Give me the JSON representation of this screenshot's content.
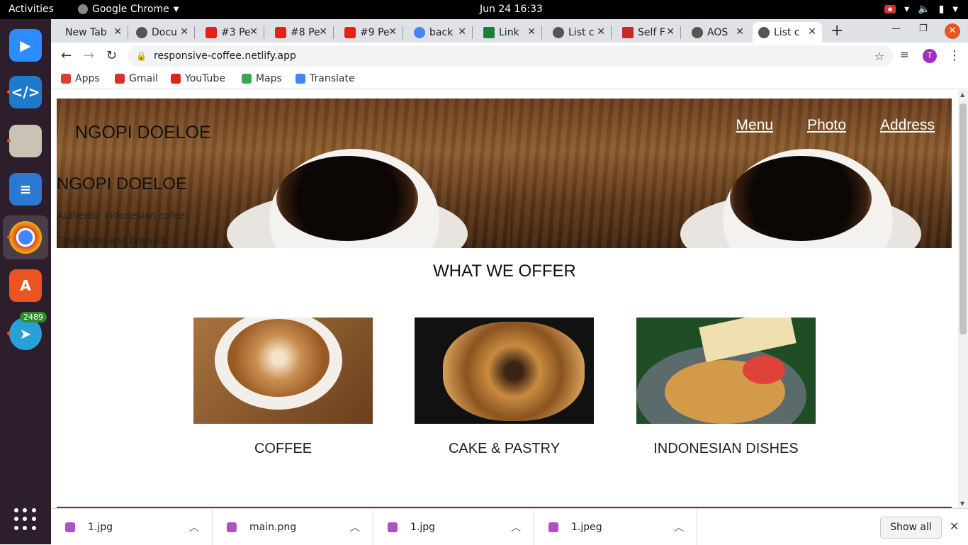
{
  "topbar": {
    "activities": "Activities",
    "app": "Google Chrome",
    "clock": "Jun 24  16:33"
  },
  "dock": {
    "items": [
      {
        "name": "zoom",
        "icon": "zoom-icon",
        "color": "#2d8cff"
      },
      {
        "name": "vscode",
        "icon": "vscode-icon",
        "color": "#1f7acc"
      },
      {
        "name": "files",
        "icon": "files-icon",
        "color": "#c9c3b6"
      },
      {
        "name": "writer",
        "icon": "writer-icon",
        "color": "#2a78d2"
      },
      {
        "name": "chrome",
        "icon": "chrome-icon",
        "color": "#4285f4"
      },
      {
        "name": "software",
        "icon": "software-store-icon",
        "color": "#e95420"
      },
      {
        "name": "telegram",
        "icon": "telegram-icon",
        "color": "#2aa0da",
        "badge": "2489"
      }
    ]
  },
  "tabs": [
    {
      "title": "New Tab",
      "fav": "none"
    },
    {
      "title": "Docu",
      "fav": "#555"
    },
    {
      "title": "#3 Pe",
      "fav": "#e62117"
    },
    {
      "title": "#8 Pe",
      "fav": "#e62117"
    },
    {
      "title": "#9 Pe",
      "fav": "#e62117"
    },
    {
      "title": "back",
      "fav": "#4285f4"
    },
    {
      "title": "Link",
      "fav": "#188038"
    },
    {
      "title": "List c",
      "fav": "#555"
    },
    {
      "title": "Self F",
      "fav": "#c62828"
    },
    {
      "title": "AOS",
      "fav": "#555"
    },
    {
      "title": "List c",
      "fav": "#555"
    }
  ],
  "address": {
    "url": "responsive-coffee.netlify.app",
    "avatar_letter": "T"
  },
  "bookmarks": [
    {
      "label": "Apps",
      "color": "#e53935"
    },
    {
      "label": "Gmail",
      "color": "#d93025"
    },
    {
      "label": "YouTube",
      "color": "#e62117"
    },
    {
      "label": "Maps",
      "color": "#34a853"
    },
    {
      "label": "Translate",
      "color": "#4285f4"
    }
  ],
  "page": {
    "brand": "NGOPI DOELOE",
    "nav": [
      "Menu",
      "Photo",
      "Address"
    ],
    "hero_title": "NGOPI DOELOE",
    "hero_line1": "Authentic Indonesian cofee.",
    "hero_line2": "Traditional and brewed.",
    "offer_title": "WHAT WE OFFER",
    "offers": [
      {
        "caption": "COFFEE"
      },
      {
        "caption": "CAKE & PASTRY"
      },
      {
        "caption": "INDONESIAN DISHES"
      }
    ]
  },
  "downloads": {
    "files": [
      "1.jpg",
      "main.png",
      "1.jpg",
      "1.jpeg"
    ],
    "show_all": "Show all"
  }
}
